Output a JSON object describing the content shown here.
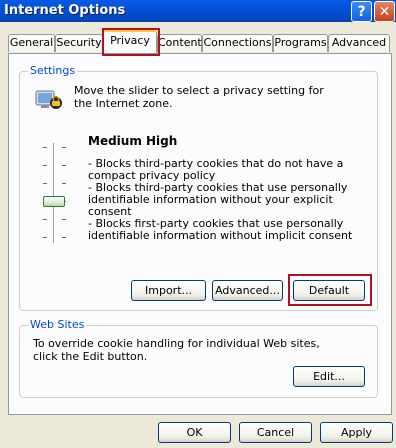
{
  "window": {
    "title": "Internet Options",
    "help_glyph": "?",
    "close_glyph": "✕"
  },
  "tabs": [
    {
      "label": "General"
    },
    {
      "label": "Security"
    },
    {
      "label": "Privacy"
    },
    {
      "label": "Content"
    },
    {
      "label": "Connections"
    },
    {
      "label": "Programs"
    },
    {
      "label": "Advanced"
    }
  ],
  "settings": {
    "group_title": "Settings",
    "intro": "Move the slider to select a privacy setting for the Internet zone.",
    "icon": "privacy-icon",
    "level_title": "Medium High",
    "level_lines": [
      "- Blocks third-party cookies that do not have a compact privacy policy",
      "- Blocks third-party cookies that use personally identifiable information without your explicit consent",
      "- Blocks first-party cookies that use personally identifiable information without implicit consent"
    ],
    "slider_level": 4,
    "slider_levels_total": 6,
    "buttons": {
      "import": "Import...",
      "advanced": "Advanced...",
      "default": "Default"
    }
  },
  "websites": {
    "group_title": "Web Sites",
    "text": "To override cookie handling for individual Web sites, click the Edit button.",
    "edit_button": "Edit..."
  },
  "footer": {
    "ok": "OK",
    "cancel": "Cancel",
    "apply": "Apply"
  },
  "colors": {
    "highlight": "#b0121b",
    "group_title": "#0046d5",
    "title_bar": "#0051d8"
  }
}
